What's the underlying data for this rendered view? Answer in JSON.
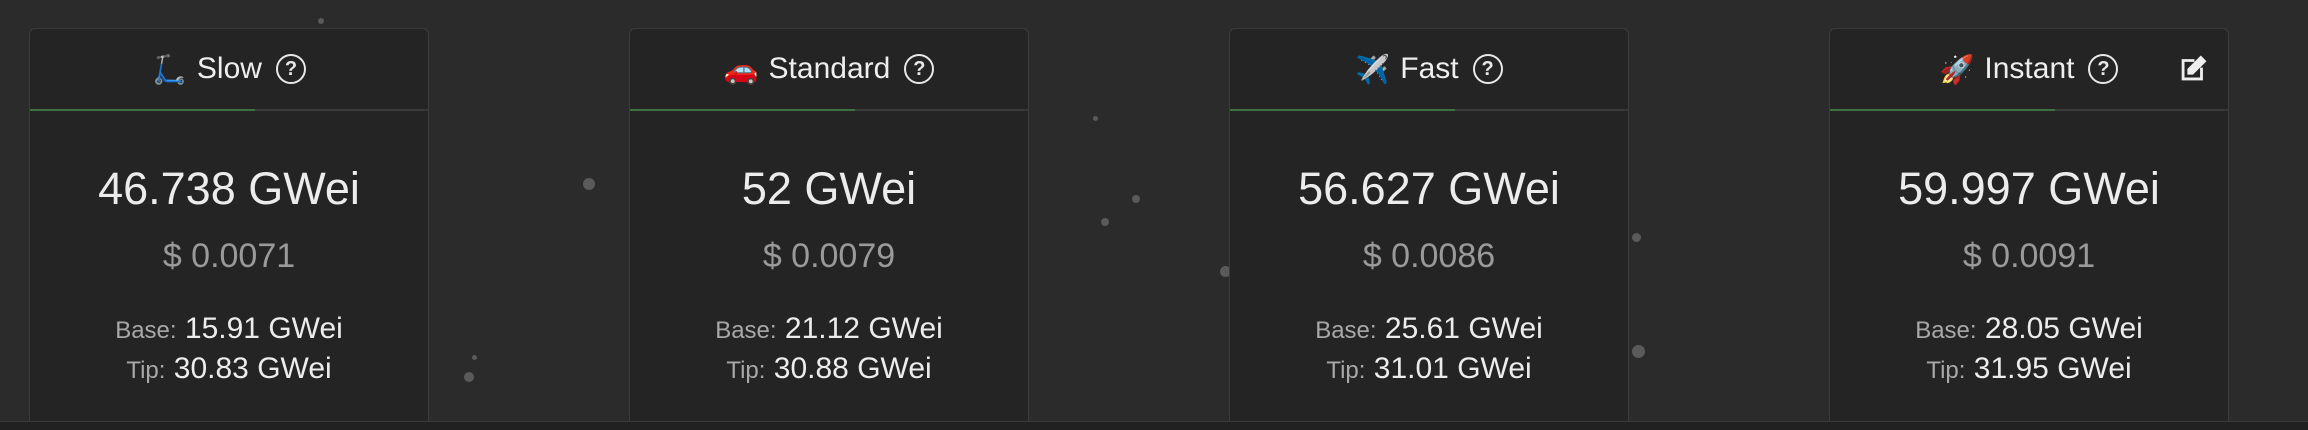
{
  "cards": [
    {
      "emoji": "🛴",
      "name": "Slow",
      "price": "46.738 GWei",
      "usd": "$ 0.0071",
      "base_label": "Base:",
      "base": "15.91 GWei",
      "tip_label": "Tip:",
      "tip": "30.83 GWei",
      "help_icon": "question-circle-icon"
    },
    {
      "emoji": "🚗",
      "name": "Standard",
      "price": "52 GWei",
      "usd": "$ 0.0079",
      "base_label": "Base:",
      "base": "21.12 GWei",
      "tip_label": "Tip:",
      "tip": "30.88 GWei",
      "help_icon": "question-circle-icon"
    },
    {
      "emoji": "✈️",
      "name": "Fast",
      "price": "56.627 GWei",
      "usd": "$ 0.0086",
      "base_label": "Base:",
      "base": "25.61 GWei",
      "tip_label": "Tip:",
      "tip": "31.01 GWei",
      "help_icon": "question-circle-icon"
    },
    {
      "emoji": "🚀",
      "name": "Instant",
      "price": "59.997 GWei",
      "usd": "$ 0.0091",
      "base_label": "Base:",
      "base": "28.05 GWei",
      "tip_label": "Tip:",
      "tip": "31.95 GWei",
      "help_icon": "question-circle-icon",
      "edit_icon": "edit-icon"
    }
  ],
  "colors": {
    "background": "#2b2b2b",
    "card": "#242424",
    "progress": "#3f6e3f",
    "muted_text": "#9a9a9a"
  }
}
